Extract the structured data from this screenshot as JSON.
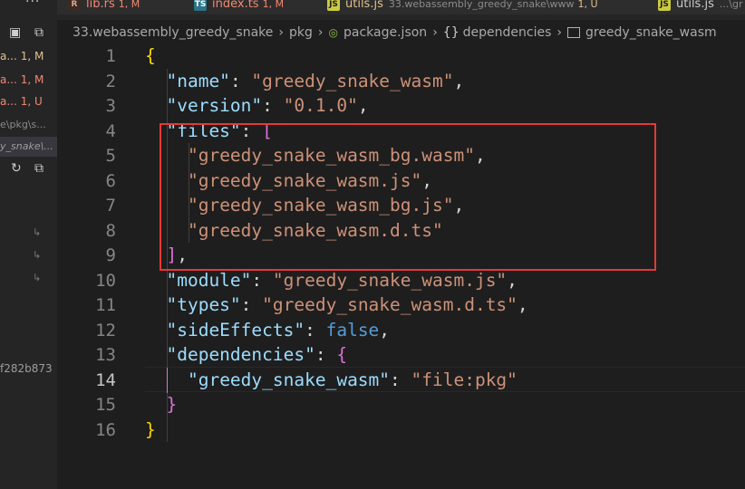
{
  "sidebar": {
    "rows": [
      {
        "name": "a...",
        "status": "1, M",
        "color": "#e2c08d"
      },
      {
        "name": "a...",
        "status": "1, M",
        "color": "#f48771"
      },
      {
        "name": "a...",
        "status": "1, U",
        "color": "#f48771"
      }
    ],
    "paths": [
      "e\\pkg\\s...",
      "y_snake\\..."
    ],
    "hash": "f282b873"
  },
  "tabs": [
    {
      "label": "lib.rs",
      "status": "1, M",
      "icon": "rust-icon"
    },
    {
      "label": "index.ts",
      "status": "1, M",
      "icon": "typescript-icon"
    },
    {
      "label": "utils.js",
      "description": "33.webassembly_greedy_snake\\www",
      "status": "1, U",
      "icon": "javascript-icon"
    },
    {
      "label": "utils.js",
      "description": "...\\gr",
      "icon": "javascript-icon"
    }
  ],
  "breadcrumb": {
    "items": [
      "33.webassembly_greedy_snake",
      "pkg",
      "package.json",
      "dependencies",
      "greedy_snake_wasm"
    ],
    "object_symbol": "{}"
  },
  "editor": {
    "line_numbers": [
      "1",
      "2",
      "3",
      "4",
      "5",
      "6",
      "7",
      "8",
      "9",
      "10",
      "11",
      "12",
      "13",
      "14",
      "15",
      "16"
    ],
    "active_line": "14",
    "code": {
      "l1_brace": "{",
      "name_key": "\"name\"",
      "name_val": "\"greedy_snake_wasm\"",
      "version_key": "\"version\"",
      "version_val": "\"0.1.0\"",
      "files_key": "\"files\"",
      "files_open": "[",
      "files": [
        "\"greedy_snake_wasm_bg.wasm\"",
        "\"greedy_snake_wasm.js\"",
        "\"greedy_snake_wasm_bg.js\"",
        "\"greedy_snake_wasm.d.ts\""
      ],
      "files_close": "]",
      "module_key": "\"module\"",
      "module_val": "\"greedy_snake_wasm.js\"",
      "types_key": "\"types\"",
      "types_val": "\"greedy_snake_wasm.d.ts\"",
      "side_key": "\"sideEffects\"",
      "side_val": "false",
      "deps_key": "\"dependencies\"",
      "deps_open": "{",
      "dep_key": "\"greedy_snake_wasm\"",
      "dep_val": "\"file:pkg\"",
      "deps_close": "}",
      "l16_brace": "}",
      "colon": ": ",
      "comma": ","
    }
  },
  "colors": {
    "highlight_box": "#e53935",
    "background": "#1e1e1e"
  }
}
